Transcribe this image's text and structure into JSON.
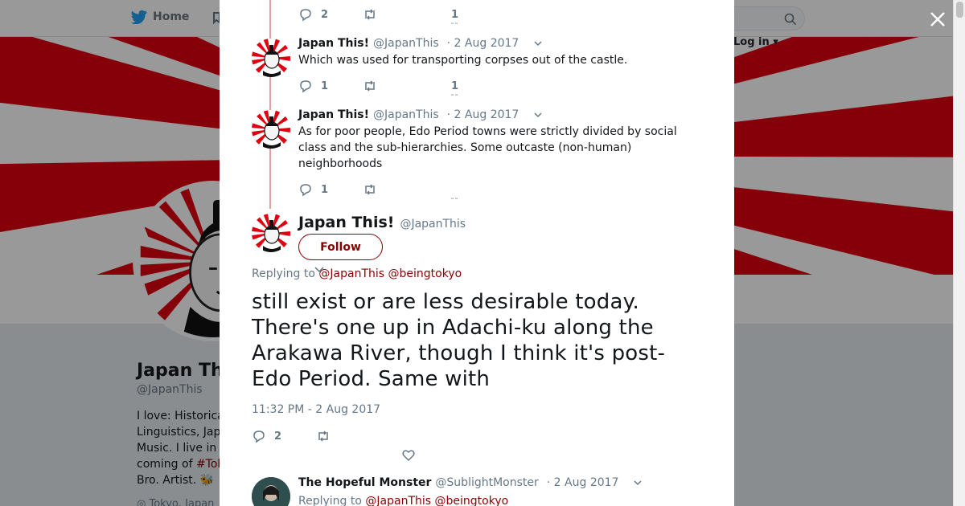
{
  "colors": {
    "accent": "#8b0000",
    "red": "#e0000f",
    "muted": "#657786",
    "text": "#14171a"
  },
  "background": {
    "nav": {
      "home_label": "Home",
      "login_label": "Log in"
    },
    "profile": {
      "name": "Japan This!",
      "handle": "@JapanThis",
      "bio_lines": [
        "I love: Historica",
        "Linguistics, Jap",
        "Music. I live in",
        "coming of ",
        "Bro. Artist. 🐝"
      ],
      "bio_hashtag": "#Tok",
      "location": "◎ Tokyo, Japan"
    }
  },
  "modal": {
    "thread": [
      {
        "replies": "2",
        "likes": "1"
      },
      {
        "name": "Japan This!",
        "handle": "@JapanThis",
        "date": "· 2 Aug 2017",
        "text": "Which was used for transporting corpses out of the castle.",
        "replies": "1",
        "likes": "1"
      },
      {
        "name": "Japan This!",
        "handle": "@JapanThis",
        "date": "· 2 Aug 2017",
        "text": "As for poor people, Edo Period towns were strictly divided by social class and the sub-hierarchies. Some outcaste (non-human) neighborhoods",
        "replies": "1"
      }
    ],
    "main_tweet": {
      "name": "Japan This!",
      "handle": "@JapanThis",
      "follow_label": "Follow",
      "replying_prefix": "Replying to",
      "replying_to": [
        "@JapanThis",
        "@beingtokyo"
      ],
      "text": "still exist or are less desirable today. There's one up in Adachi-ku along the Arakawa River, though I think it's post-Edo Period. Same with",
      "timestamp": "11:32 PM - 2 Aug 2017",
      "replies": "2"
    },
    "reply": {
      "name": "The Hopeful Monster",
      "handle": "@SublightMonster",
      "date": "· 2 Aug 2017",
      "replying_prefix": "Replying to",
      "replying_to": [
        "@JapanThis",
        "@beingtokyo"
      ]
    }
  }
}
